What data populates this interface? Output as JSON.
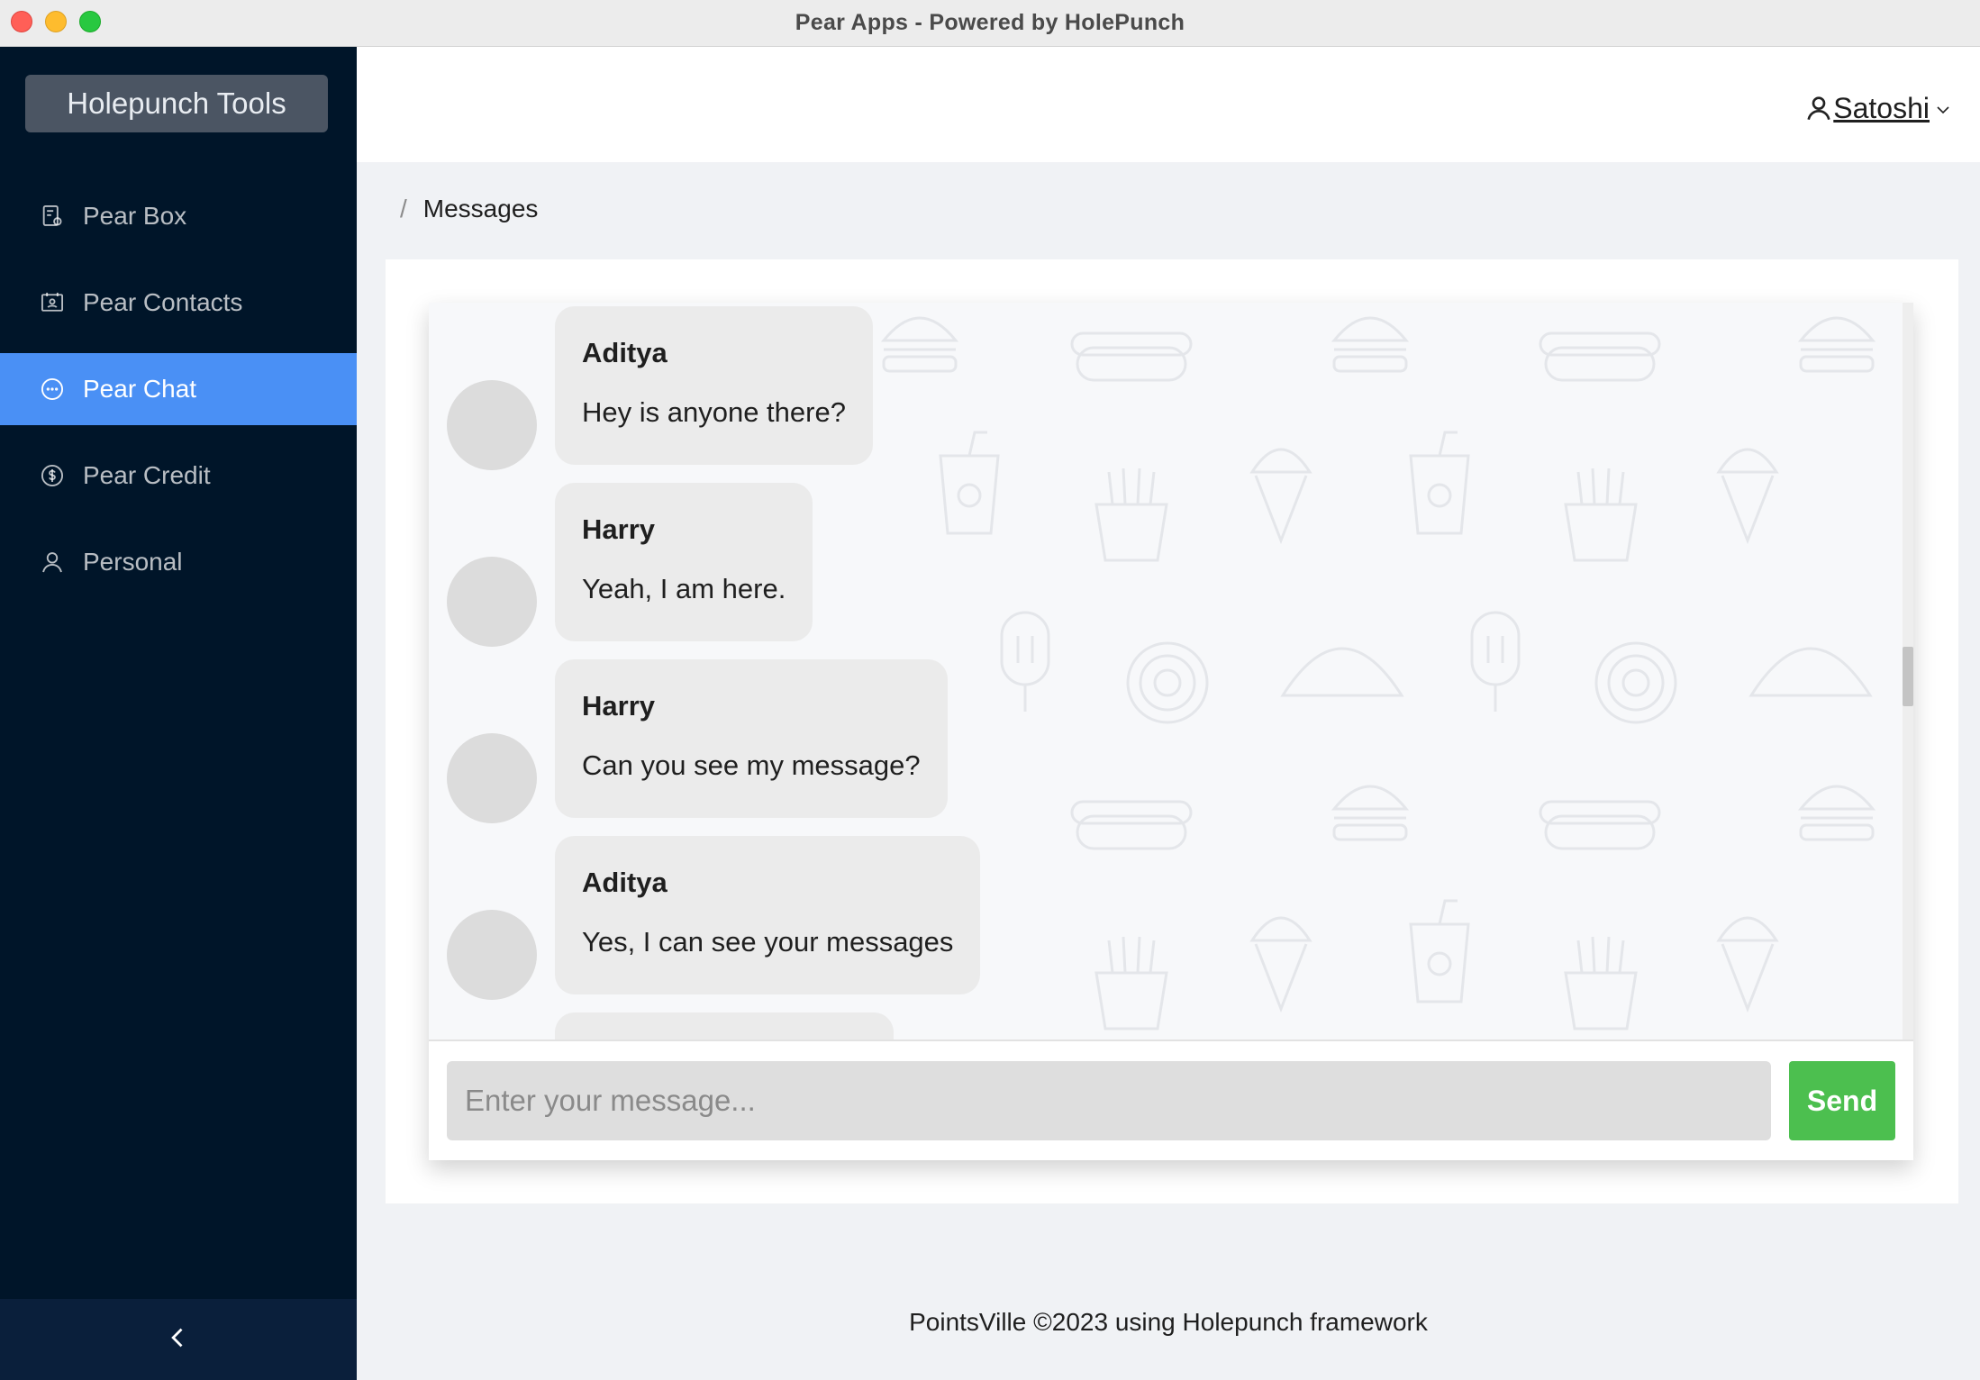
{
  "window": {
    "title": "Pear Apps - Powered by HolePunch"
  },
  "sidebar": {
    "brand": "Holepunch Tools",
    "items": [
      {
        "label": "Pear Box",
        "icon": "box-icon",
        "active": false
      },
      {
        "label": "Pear Contacts",
        "icon": "contacts-icon",
        "active": false
      },
      {
        "label": "Pear Chat",
        "icon": "chat-icon",
        "active": true
      },
      {
        "label": "Pear Credit",
        "icon": "dollar-icon",
        "active": false
      },
      {
        "label": "Personal",
        "icon": "user-icon",
        "active": false
      }
    ],
    "collapse_icon": "chevron-left-icon"
  },
  "header": {
    "user_name": "Satoshi"
  },
  "breadcrumb": {
    "separator": "/",
    "current": "Messages"
  },
  "chat": {
    "messages": [
      {
        "sender": "Aditya",
        "text": "Hey is anyone there?"
      },
      {
        "sender": "Harry",
        "text": "Yeah, I am here."
      },
      {
        "sender": "Harry",
        "text": "Can you see my message?"
      },
      {
        "sender": "Aditya",
        "text": "Yes, I can see your messages"
      }
    ],
    "input_placeholder": "Enter your message...",
    "input_value": "",
    "send_label": "Send"
  },
  "footer": {
    "text": "PointsVille ©2023 using Holepunch framework"
  },
  "colors": {
    "sidebar_bg": "#001529",
    "active_item": "#4a90f5",
    "send_button": "#4cbf4f"
  }
}
